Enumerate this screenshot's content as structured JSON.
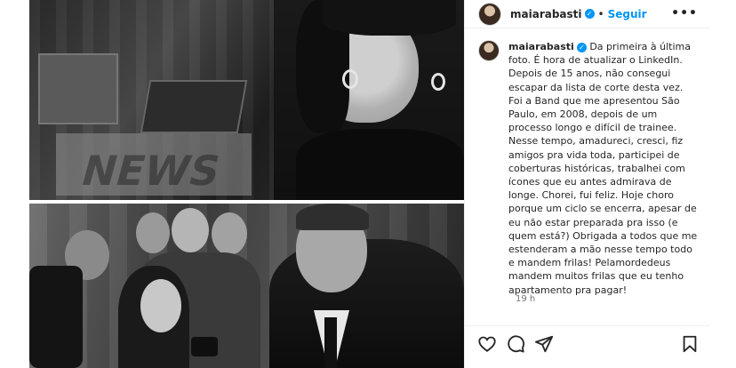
{
  "post": {
    "username": "maiarabasti",
    "verified_mark": "✓",
    "separator": "•",
    "follow_label": "Seguir",
    "more_label": "•••",
    "caption": "Da primeira à última foto. É hora de atualizar o LinkedIn. Depois de 15 anos, não consegui escapar da lista de corte desta vez. Foi a Band que me apresentou São Paulo, em 2008, depois de um processo longo e difícil de trainee. Nesse tempo, amadureci, cresci, fiz amigos pra vida toda, participei de coberturas históricas, trabalhei com ícones que eu antes admirava de longe. Chorei, fui feliz. Hoje choro porque um ciclo se encerra, apesar de eu não estar preparada pra isso (e quem está?) Obrigada a todos que me estenderam a mão nesse tempo todo e mandem frilas! Pelamordedeus mandem muitos frilas que eu tenho apartamento pra pagar!",
    "timestamp": "19 h"
  },
  "photos": {
    "top_alt": "woman-smiling-newsroom-photo",
    "bottom_alt": "reporter-interview-photo"
  },
  "icons": {
    "like": "heart-icon",
    "comment": "comment-icon",
    "share": "share-icon",
    "save": "bookmark-icon"
  },
  "colors": {
    "accent": "#0095f6",
    "text": "#262626",
    "muted": "#737373"
  }
}
